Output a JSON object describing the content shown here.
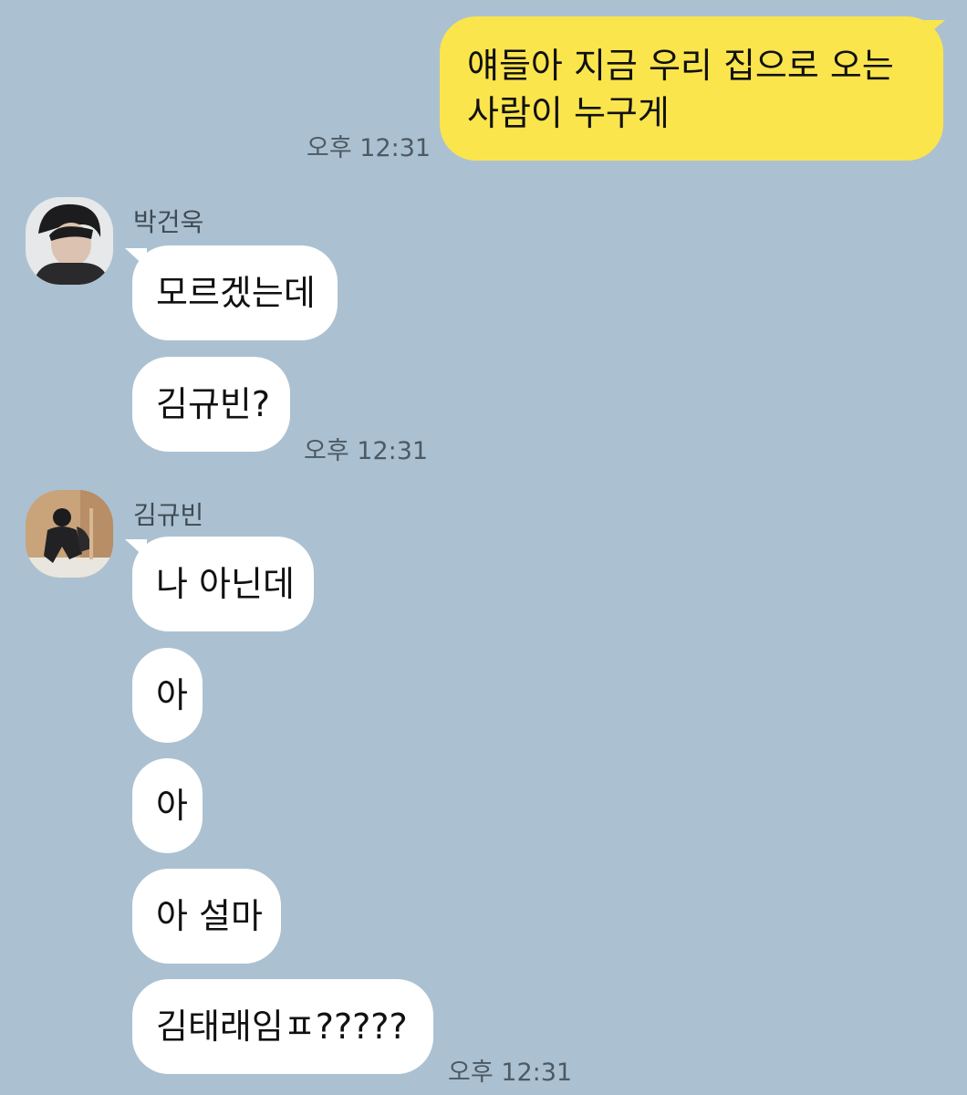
{
  "chat": {
    "outgoing": {
      "message": "얘들아 지금 우리 집으로 오는 사람이 누구게",
      "time": "오후 12:31"
    },
    "groups": [
      {
        "sender": "박건욱",
        "avatar": "user-avatar-photo",
        "messages": [
          "모르겠는데",
          "김규빈?"
        ],
        "time": "오후 12:31"
      },
      {
        "sender": "김규빈",
        "avatar": "user-avatar-photo",
        "messages": [
          "나 아닌데",
          "아",
          "아",
          "아 설마",
          "김태래임ㅍ?????"
        ],
        "time": "오후 12:31"
      }
    ]
  },
  "colors": {
    "background": "#abc1d1",
    "outgoing_bubble": "#fbe54d",
    "incoming_bubble": "#ffffff",
    "timestamp_text": "#4d5963"
  }
}
